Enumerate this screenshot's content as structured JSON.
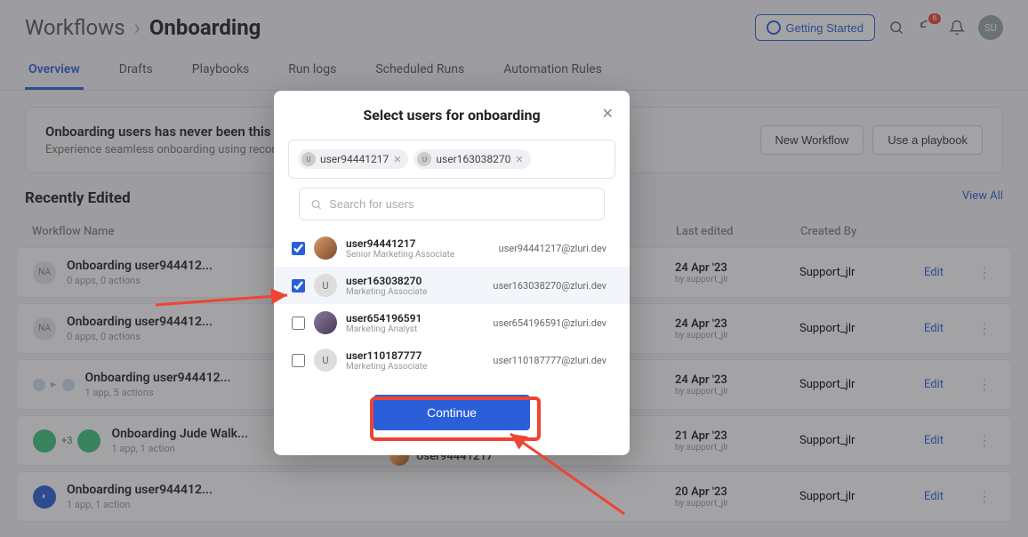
{
  "breadcrumb": {
    "parent": "Workflows",
    "current": "Onboarding"
  },
  "topbar": {
    "getting_started": "Getting Started",
    "notif_count": "6",
    "avatar": "SU"
  },
  "tabs": [
    "Overview",
    "Drafts",
    "Playbooks",
    "Run logs",
    "Scheduled Runs",
    "Automation Rules"
  ],
  "banner": {
    "title": "Onboarding users has never been this simple",
    "sub": "Experience seamless onboarding using recommended actions",
    "new_workflow": "New Workflow",
    "use_playbook": "Use a playbook"
  },
  "section": {
    "title": "Recently Edited",
    "view_all": "View All"
  },
  "table": {
    "head": {
      "name": "Workflow Name",
      "edited": "Last edited",
      "created": "Created By"
    },
    "rows": [
      {
        "icon": "na",
        "name": "Onboarding user944412...",
        "sub": "0 apps, 0 actions",
        "date": "24 Apr '23",
        "by": "by support_jlr",
        "creator": "Support_jlr",
        "action": "Edit"
      },
      {
        "icon": "na",
        "name": "Onboarding user944412...",
        "sub": "0 apps, 0 actions",
        "date": "24 Apr '23",
        "by": "by support_jlr",
        "creator": "Support_jlr",
        "action": "Edit"
      },
      {
        "icon": "dots",
        "name": "Onboarding user944412...",
        "sub": "1 app, 5 actions",
        "date": "24 Apr '23",
        "by": "by support_jlr",
        "creator": "Support_jlr",
        "action": "Edit"
      },
      {
        "icon": "green",
        "plus": "+3",
        "name": "Onboarding Jude Walk...",
        "sub": "1 app, 1 action",
        "date": "21 Apr '23",
        "by": "by support_jlr",
        "creator": "Support_jlr",
        "action": "Edit"
      },
      {
        "icon": "blue",
        "name": "Onboarding user944412...",
        "sub": "1 app, 1 action",
        "date": "20 Apr '23",
        "by": "by support_jlr",
        "creator": "Support_jlr",
        "action": "Edit"
      }
    ]
  },
  "modal": {
    "title": "Select users for onboarding",
    "chips": [
      {
        "av": "U",
        "label": "user94441217"
      },
      {
        "av": "U",
        "label": "user163038270"
      }
    ],
    "search_placeholder": "Search for users",
    "users": [
      {
        "checked": true,
        "avatar": "photo1",
        "name": "user94441217",
        "role": "Senior Marketing Associate",
        "email": "user94441217@zluri.dev"
      },
      {
        "checked": true,
        "avatar": "U",
        "name": "user163038270",
        "role": "Marketing Associate",
        "email": "user163038270@zluri.dev"
      },
      {
        "checked": false,
        "avatar": "photo2",
        "name": "user654196591",
        "role": "Marketing Analyst",
        "email": "user654196591@zluri.dev"
      },
      {
        "checked": false,
        "avatar": "U",
        "name": "user110187777",
        "role": "Marketing Associate",
        "email": "user110187777@zluri.dev"
      }
    ],
    "continue": "Continue"
  },
  "bottom_user": "User94441217"
}
